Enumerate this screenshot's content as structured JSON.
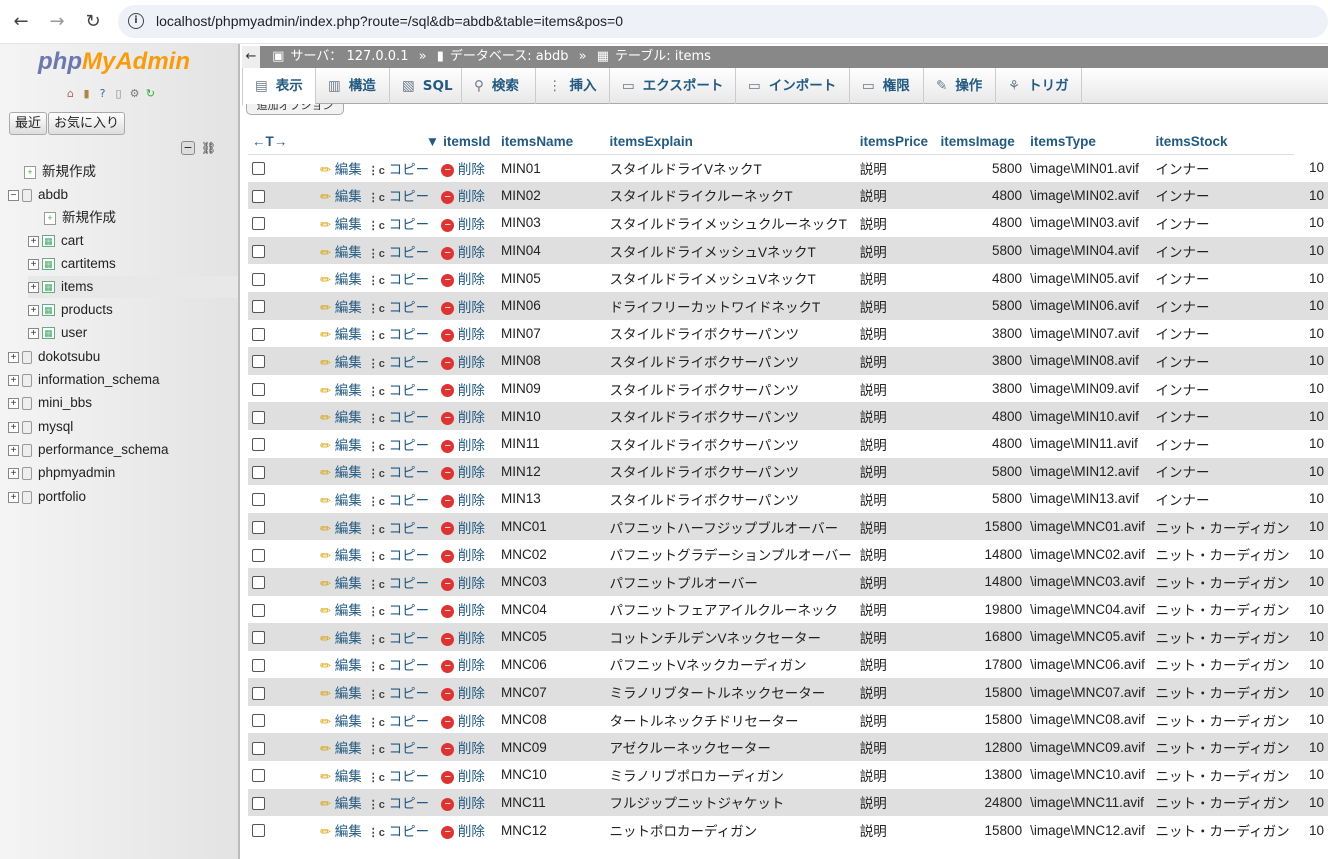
{
  "browser": {
    "back": "←",
    "forward": "→",
    "reload": "↻",
    "url": "localhost/phpmyadmin/index.php?route=/sql&db=abdb&table=items&pos=0"
  },
  "sidebar": {
    "logo_a": "php",
    "logo_b": "MyAdmin",
    "recent": "最近",
    "favorites": "お気に入り",
    "new": "新規作成",
    "abdb": "abdb",
    "abdb_new": "新規作成",
    "tables": [
      "cart",
      "cartitems",
      "items",
      "products",
      "user"
    ],
    "dbs": [
      "dokotsubu",
      "information_schema",
      "mini_bbs",
      "mysql",
      "performance_schema",
      "phpmyadmin",
      "portfolio"
    ]
  },
  "crumb": {
    "server": "サーバ： 127.0.0.1",
    "database": "データベース: abdb",
    "table": "テーブル: items",
    "sep": "»"
  },
  "tabs": [
    "表示",
    "構造",
    "SQL",
    "検索",
    "挿入",
    "エクスポート",
    "インポート",
    "権限",
    "操作",
    "トリガ"
  ],
  "extra_options": "追加オプション",
  "actions": {
    "edit": "編集",
    "copy": "コピー",
    "delete": "削除"
  },
  "columns": [
    "itemsId",
    "itemsName",
    "itemsExplain",
    "itemsPrice",
    "itemsImage",
    "itemsType",
    "itemsStock"
  ],
  "rows": [
    [
      "MIN01",
      "スタイルドライVネックT",
      "説明",
      "5800",
      "\\image\\MIN01.avif",
      "インナー",
      "10"
    ],
    [
      "MIN02",
      "スタイルドライクルーネックT",
      "説明",
      "4800",
      "\\image\\MIN02.avif",
      "インナー",
      "10"
    ],
    [
      "MIN03",
      "スタイルドライメッシュクルーネックT",
      "説明",
      "4800",
      "\\image\\MIN03.avif",
      "インナー",
      "10"
    ],
    [
      "MIN04",
      "スタイルドライメッシュVネックT",
      "説明",
      "5800",
      "\\image\\MIN04.avif",
      "インナー",
      "10"
    ],
    [
      "MIN05",
      "スタイルドライメッシュVネックT",
      "説明",
      "4800",
      "\\image\\MIN05.avif",
      "インナー",
      "10"
    ],
    [
      "MIN06",
      "ドライフリーカットワイドネックT",
      "説明",
      "5800",
      "\\image\\MIN06.avif",
      "インナー",
      "10"
    ],
    [
      "MIN07",
      "スタイルドライボクサーパンツ",
      "説明",
      "3800",
      "\\image\\MIN07.avif",
      "インナー",
      "10"
    ],
    [
      "MIN08",
      "スタイルドライボクサーパンツ",
      "説明",
      "3800",
      "\\image\\MIN08.avif",
      "インナー",
      "10"
    ],
    [
      "MIN09",
      "スタイルドライボクサーパンツ",
      "説明",
      "3800",
      "\\image\\MIN09.avif",
      "インナー",
      "10"
    ],
    [
      "MIN10",
      "スタイルドライボクサーパンツ",
      "説明",
      "4800",
      "\\image\\MIN10.avif",
      "インナー",
      "10"
    ],
    [
      "MIN11",
      "スタイルドライボクサーパンツ",
      "説明",
      "4800",
      "\\image\\MIN11.avif",
      "インナー",
      "10"
    ],
    [
      "MIN12",
      "スタイルドライボクサーパンツ",
      "説明",
      "5800",
      "\\image\\MIN12.avif",
      "インナー",
      "10"
    ],
    [
      "MIN13",
      "スタイルドライボクサーパンツ",
      "説明",
      "5800",
      "\\image\\MIN13.avif",
      "インナー",
      "10"
    ],
    [
      "MNC01",
      "パフニットハーフジップブルオーバー",
      "説明",
      "15800",
      "\\image\\MNC01.avif",
      "ニット・カーディガン",
      "10"
    ],
    [
      "MNC02",
      "パフニットグラデーションプルオーバー",
      "説明",
      "14800",
      "\\image\\MNC02.avif",
      "ニット・カーディガン",
      "10"
    ],
    [
      "MNC03",
      "パフニットプルオーバー",
      "説明",
      "14800",
      "\\image\\MNC03.avif",
      "ニット・カーディガン",
      "10"
    ],
    [
      "MNC04",
      "パフニットフェアアイルクルーネック",
      "説明",
      "19800",
      "\\image\\MNC04.avif",
      "ニット・カーディガン",
      "10"
    ],
    [
      "MNC05",
      "コットンチルデンVネックセーター",
      "説明",
      "16800",
      "\\image\\MNC05.avif",
      "ニット・カーディガン",
      "10"
    ],
    [
      "MNC06",
      "パフニットVネックカーディガン",
      "説明",
      "17800",
      "\\image\\MNC06.avif",
      "ニット・カーディガン",
      "10"
    ],
    [
      "MNC07",
      "ミラノリブタートルネックセーター",
      "説明",
      "15800",
      "\\image\\MNC07.avif",
      "ニット・カーディガン",
      "10"
    ],
    [
      "MNC08",
      "タートルネックチドリセーター",
      "説明",
      "15800",
      "\\image\\MNC08.avif",
      "ニット・カーディガン",
      "10"
    ],
    [
      "MNC09",
      "アゼクルーネックセーター",
      "説明",
      "12800",
      "\\image\\MNC09.avif",
      "ニット・カーディガン",
      "10"
    ],
    [
      "MNC10",
      "ミラノリブポロカーディガン",
      "説明",
      "13800",
      "\\image\\MNC10.avif",
      "ニット・カーディガン",
      "10"
    ],
    [
      "MNC11",
      "フルジップニットジャケット",
      "説明",
      "24800",
      "\\image\\MNC11.avif",
      "ニット・カーディガン",
      "10"
    ],
    [
      "MNC12",
      "ニットポロカーディガン",
      "説明",
      "15800",
      "\\image\\MNC12.avif",
      "ニット・カーディガン",
      "10"
    ]
  ]
}
